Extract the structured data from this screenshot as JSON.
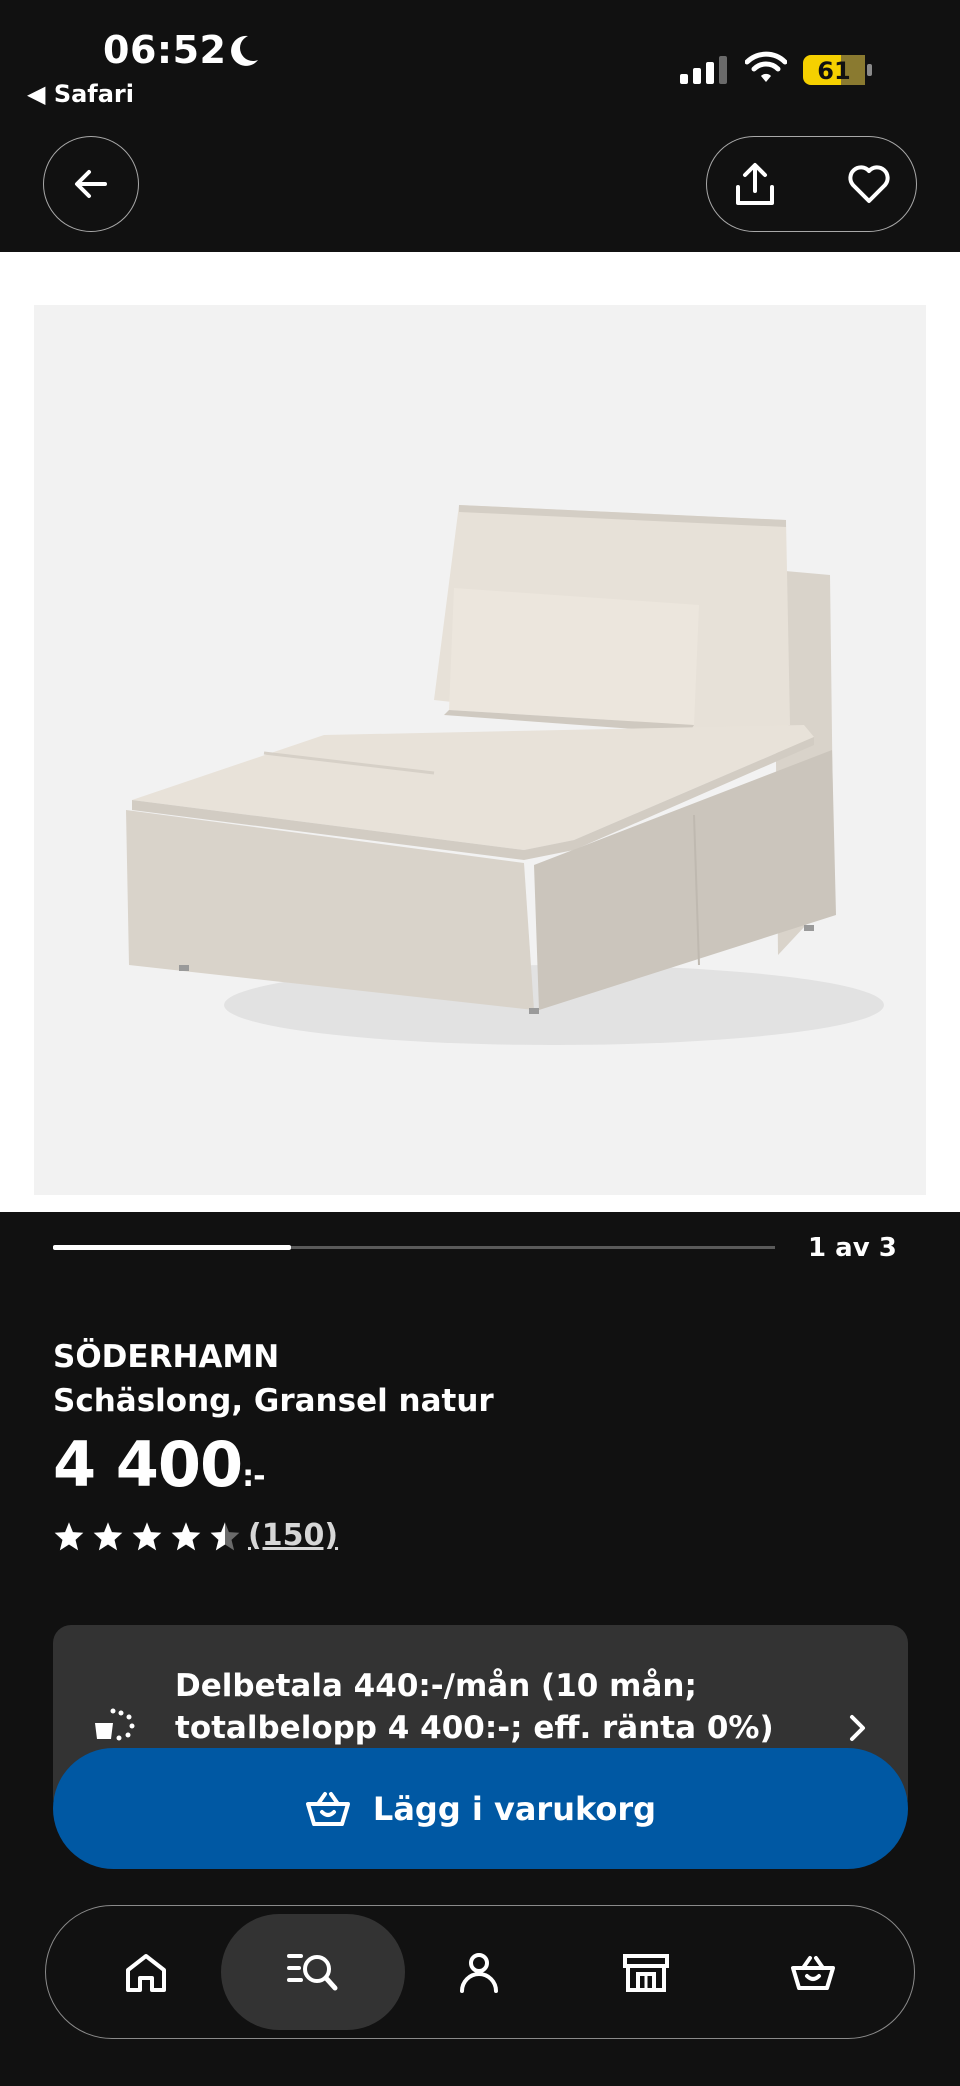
{
  "status_bar": {
    "time": "06:52",
    "back_app": "◀ Safari",
    "battery": "61"
  },
  "header": {
    "back_icon": "arrow-left-icon",
    "share_icon": "share-icon",
    "favorite_icon": "heart-icon"
  },
  "gallery": {
    "counter": "1 av 3",
    "progress": 0.33
  },
  "product": {
    "name": "SÖDERHAMN",
    "description": "Schäslong, Gransel natur",
    "price": "4 400",
    "price_suffix": ":-",
    "rating": 4.5,
    "review_count": "(150)"
  },
  "installment": {
    "text": "Delbetala 440:-/mån (10 mån; totalbelopp 4 400:-; eff. ränta 0%)"
  },
  "cart": {
    "label": "Lägg i varukorg"
  },
  "nav": {
    "items": [
      "home-icon",
      "search-icon",
      "profile-icon",
      "store-icon",
      "cart-icon"
    ],
    "active": "search-icon"
  },
  "colors": {
    "background": "#111111",
    "accent_blue": "#0058a3",
    "battery_yellow": "#f5d000",
    "card_gray": "#333333"
  }
}
